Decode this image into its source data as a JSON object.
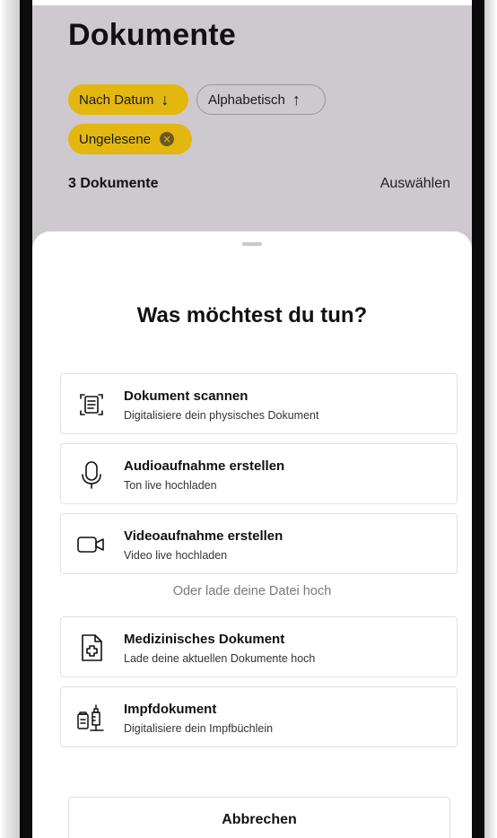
{
  "header": {
    "title": "Dokumente",
    "sort_date": {
      "label": "Nach Datum",
      "direction_icon": "arrow-down-icon"
    },
    "sort_alpha": {
      "label": "Alphabetisch",
      "direction_icon": "arrow-up-icon"
    },
    "filter_unread": {
      "label": "Ungelesene",
      "remove_icon": "close-circle-icon"
    },
    "count": "3 Dokumente",
    "select": "Auswählen"
  },
  "sheet": {
    "title": "Was möchtest du tun?",
    "options": [
      {
        "title": "Dokument scannen",
        "subtitle": "Digitalisiere dein physisches Dokument",
        "icon": "scan-document-icon"
      },
      {
        "title": "Audioaufnahme erstellen",
        "subtitle": "Ton live hochladen",
        "icon": "microphone-icon"
      },
      {
        "title": "Videoaufnahme erstellen",
        "subtitle": "Video live hochladen",
        "icon": "video-camera-icon"
      }
    ],
    "upload_divider": "Oder lade deine Datei hoch",
    "upload_options": [
      {
        "title": "Medizinisches Dokument",
        "subtitle": "Lade deine aktuellen Dokumente hoch",
        "icon": "medical-document-icon"
      },
      {
        "title": "Impfdokument",
        "subtitle": "Digitalisiere dein Impfbüchlein",
        "icon": "vaccination-document-icon"
      }
    ],
    "cancel": "Abbrechen"
  },
  "colors": {
    "accent": "#e3b70f",
    "background_dimmed": "#cdc9cf",
    "sheet": "#ffffff"
  }
}
